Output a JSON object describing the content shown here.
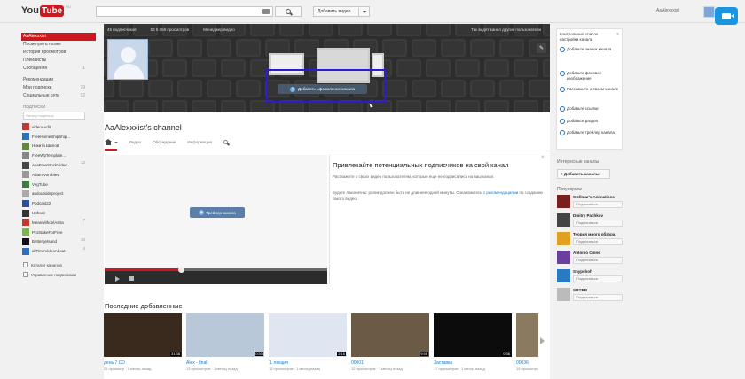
{
  "topbar": {
    "logo_you": "You",
    "logo_tube": "Tube",
    "logo_suffix": "RU",
    "upload_label": "Добавить видео",
    "username": "AaAlexxxist"
  },
  "sidebar": {
    "nav": [
      {
        "label": "AaAlexxxist",
        "active": true
      },
      {
        "label": "Посмотреть позже"
      },
      {
        "label": "История просмотров"
      },
      {
        "label": "Плейлисты"
      },
      {
        "label": "Сообщения",
        "count": "1"
      }
    ],
    "more": [
      {
        "label": "Рекомендации"
      },
      {
        "label": "Мои подписки",
        "count": "79"
      },
      {
        "label": "Социальные сети",
        "count": "12"
      }
    ],
    "subs_heading": "ПОДПИСКИ",
    "filter_placeholder": "Фильтр подписок",
    "subscriptions": [
      {
        "label": "videoAudit",
        "color": "#cc3333"
      },
      {
        "label": "FreeHomeShipShip...",
        "color": "#2a6fc2"
      },
      {
        "label": "Никита Шилов",
        "color": "#5a8a3a"
      },
      {
        "label": "FreeWpTemplate...",
        "color": "#888888"
      },
      {
        "label": "AkaFreeStockVideo",
        "count": "12",
        "color": "#444444"
      },
      {
        "label": "Adam Voroblev",
        "color": "#999999"
      },
      {
        "label": "VegTube",
        "color": "#3a7a3a"
      },
      {
        "label": "andoutsideproject",
        "color": "#aaaaaa"
      },
      {
        "label": "Podcast22",
        "color": "#2b4fa0"
      },
      {
        "label": "Upfront",
        "color": "#333333"
      },
      {
        "label": "MeanwithonlAstra",
        "count": "7",
        "color": "#c0392b"
      },
      {
        "label": "ProStakeForFree",
        "color": "#7ab648"
      },
      {
        "label": "Bettergetsand",
        "count": "10",
        "color": "#111111"
      },
      {
        "label": "allTimeVideoAbout",
        "count": "4",
        "color": "#2a6fc2"
      }
    ],
    "bottom": [
      {
        "label": "Каталог каналов"
      },
      {
        "label": "Управление подписками"
      }
    ]
  },
  "banner": {
    "stats": [
      "45 подписчиков",
      "53 5 069 просмотров",
      "Менеджер видео"
    ],
    "view_as": "Так видят канал другие пользователи",
    "add_art": "Добавить оформление канала"
  },
  "channel": {
    "title": "AaAlexxxist's channel",
    "tabs": [
      "Видео",
      "Обсуждение",
      "Информация"
    ]
  },
  "player": {
    "trailer_btn": "Трейлер канала"
  },
  "promo": {
    "title": "Привлекайте потенциальных подписчиков на свой канал",
    "text1": "Расскажите о своих видео пользователям, которые еще не подписались на ваш канал.",
    "text2_before": "Будьте лаконичны: ролик должен быть не длиннее одной минуты. Ознакомьтесь с ",
    "text2_link": "рекомендациями",
    "text2_after": " по созданию такого видео."
  },
  "recent": {
    "title": "Последние добавленные",
    "videos": [
      {
        "title": "день 7 CD",
        "views": "21 просмотр",
        "age": "1 месяц назад",
        "duration": "31:38",
        "bg": "#3a2a1e"
      },
      {
        "title": "Alex - final",
        "views": "13 просмотров",
        "age": "1 месяц назад",
        "duration": "0:50",
        "bg": "#b9c8d8"
      },
      {
        "title": "1. лекция",
        "views": "13 просмотров",
        "age": "1 месяц назад",
        "duration": "2:16",
        "bg": "#dfe6f2"
      },
      {
        "title": "00001",
        "views": "12 просмотров",
        "age": "1 месяц назад",
        "duration": "9:56",
        "bg": "#6b5a45"
      },
      {
        "title": "Заставка",
        "views": "17 просмотров",
        "age": "1 месяц назад",
        "duration": "0:36",
        "bg": "#0c0c0c"
      },
      {
        "title": "00036",
        "views": "15 просмотров",
        "age": "1 месяц назад",
        "duration": "",
        "bg": "#8a7a60"
      }
    ]
  },
  "checklist": {
    "title": "Контрольный список настройки канала",
    "items": [
      "Добавьте значок канала",
      "Добавьте фоновое изображение",
      "Расскажите о своем канале",
      "Добавьте ссылки",
      "Добавьте раздел",
      "Добавьте трейлер канала"
    ]
  },
  "interesting": {
    "heading": "Интересные каналы",
    "add_btn": "+ Добавить каналы"
  },
  "popular": {
    "heading": "Популярное",
    "subscribe_label": "Подписаться",
    "channels": [
      {
        "name": "Stellmar's Animations",
        "color": "#7a1f1f"
      },
      {
        "name": "Dmitry Pachkov",
        "color": "#444444"
      },
      {
        "name": "Теория много обзора",
        "color": "#e0a020"
      },
      {
        "name": "Antonio Cinne",
        "color": "#6a3fa0"
      },
      {
        "name": "Snypshoft",
        "color": "#2a7ac2"
      },
      {
        "name": "CBYDB",
        "color": "#bbbbbb"
      }
    ]
  }
}
